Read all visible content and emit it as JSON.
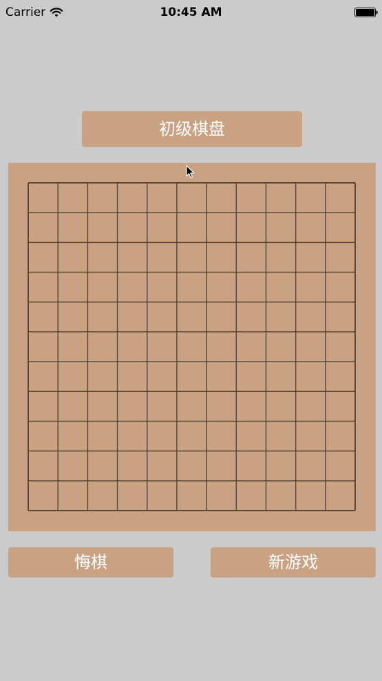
{
  "status_bar": {
    "carrier": "Carrier",
    "time": "10:45 AM",
    "icons": [
      "wifi-icon",
      "battery-icon"
    ]
  },
  "level_button": {
    "label": "初级棋盘"
  },
  "board": {
    "rows": 11,
    "columns": 11,
    "background_color": "#c9a283",
    "line_color": "#4a3a2c"
  },
  "actions": {
    "undo_label": "悔棋",
    "new_game_label": "新游戏"
  },
  "colors": {
    "background": "#cbcbcb",
    "button": "#c9a283",
    "button_text": "#ffffff"
  }
}
